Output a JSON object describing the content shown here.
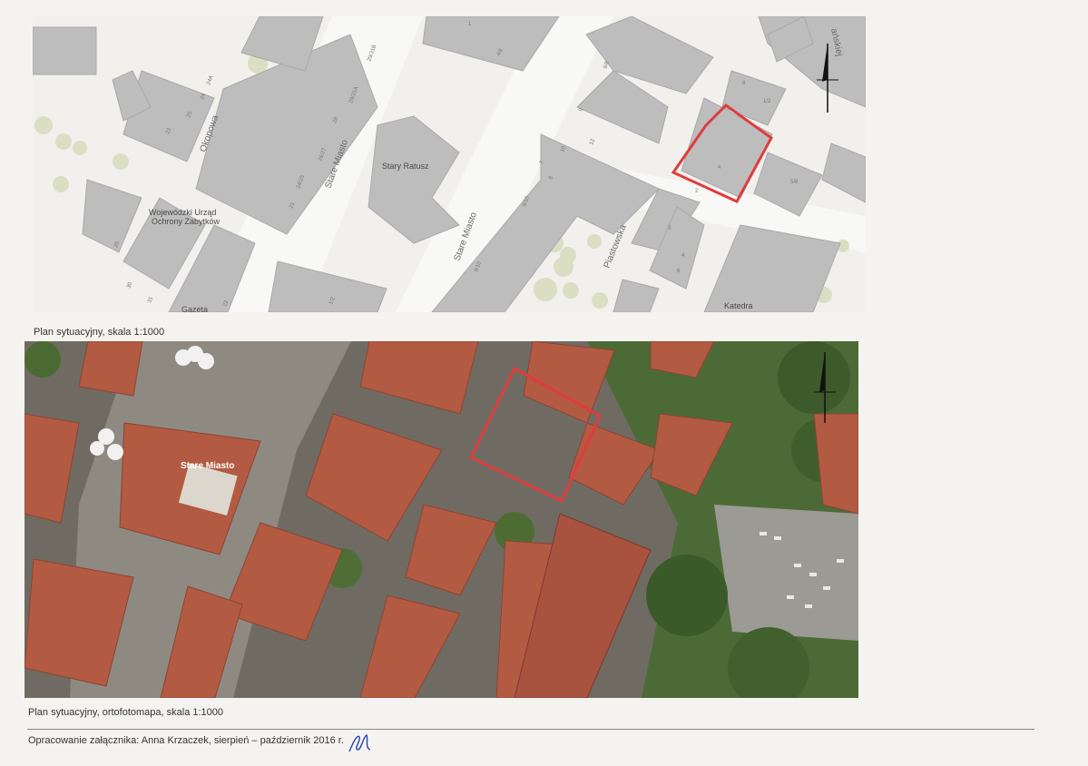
{
  "map_plan": {
    "labels": {
      "street_okopowa": "Okopowa",
      "street_stare_miasto_1": "Stare Miasto",
      "street_stare_miasto_2": "Stare Miasto",
      "street_piastowska": "Piastowska",
      "street_top_right_partial": "ańskiej",
      "stary_ratusz": "Stary Ratusz",
      "urzad_line1": "Wojewódzki Urząd",
      "urzad_line2": "Ochrony Zabytków",
      "katedra": "Katedra",
      "gazeta_partial": "Gazeta"
    },
    "house_numbers": [
      "4/6",
      "1",
      "23",
      "25",
      "24",
      "24A",
      "28",
      "29/31A",
      "29/31B",
      "26/27",
      "24/25",
      "21",
      "20",
      "22",
      "30",
      "31",
      "1/2",
      "6/8",
      "9/10",
      "12",
      "9",
      "10",
      "7",
      "8",
      "9/10",
      "5/6",
      "4",
      "2",
      "3",
      "4",
      "6",
      "8",
      "1/2"
    ],
    "highlight_color": "#e03c3c",
    "north_arrow": "north-arrow-icon"
  },
  "ortho_plan": {
    "labels": {
      "stare_miasto": "Stare Miasto"
    },
    "highlight_color": "#e03c3c",
    "north_arrow": "north-arrow-icon"
  },
  "captions": {
    "map": "Plan sytuacyjny, skala 1:1000",
    "ortho": "Plan sytuacyjny, ortofotomapa, skala 1:1000"
  },
  "footer": {
    "text": "Opracowanie załącznika: Anna Krzaczek, sierpień – październik 2016 r."
  }
}
